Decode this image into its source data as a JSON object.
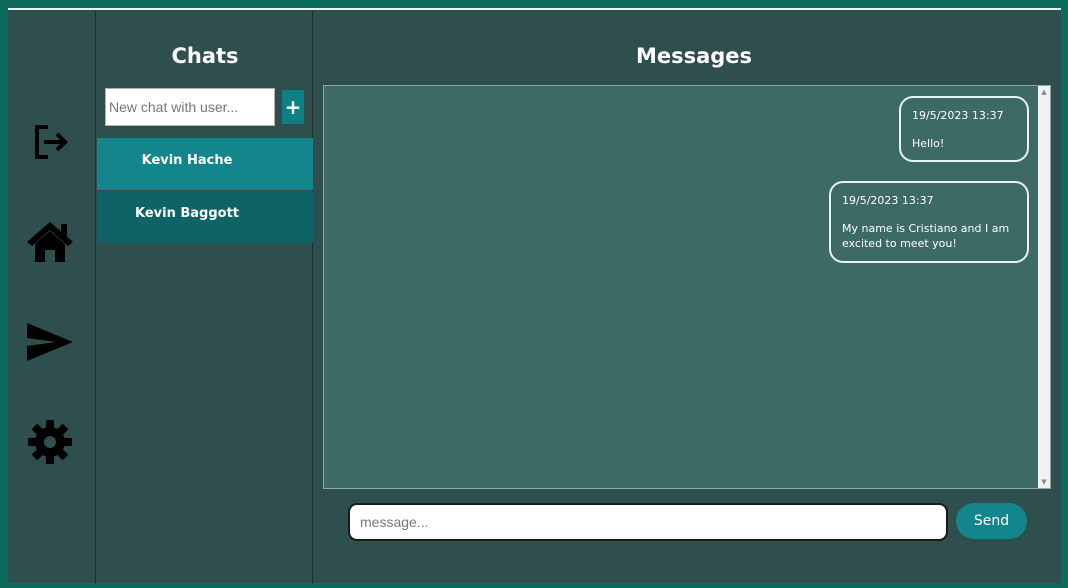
{
  "sidebar": {
    "icons": [
      "logout-icon",
      "home-icon",
      "send-icon",
      "settings-icon"
    ]
  },
  "chats": {
    "title": "Chats",
    "new_chat_placeholder": "New chat with user...",
    "add_label": "+",
    "items": [
      {
        "name": "Kevin Hache"
      },
      {
        "name": "Kevin Baggott"
      }
    ]
  },
  "messages": {
    "title": "Messages",
    "list": [
      {
        "time": "19/5/2023 13:37",
        "text": "Hello!"
      },
      {
        "time": "19/5/2023 13:37",
        "text": "My name is Cristiano and I am excited to meet you!"
      }
    ],
    "input_placeholder": "message...",
    "send_label": "Send"
  },
  "colors": {
    "background": "#2f4f4f",
    "accent": "#12868a",
    "message_area": "#3d6966",
    "outer": "#0c6b5a"
  }
}
